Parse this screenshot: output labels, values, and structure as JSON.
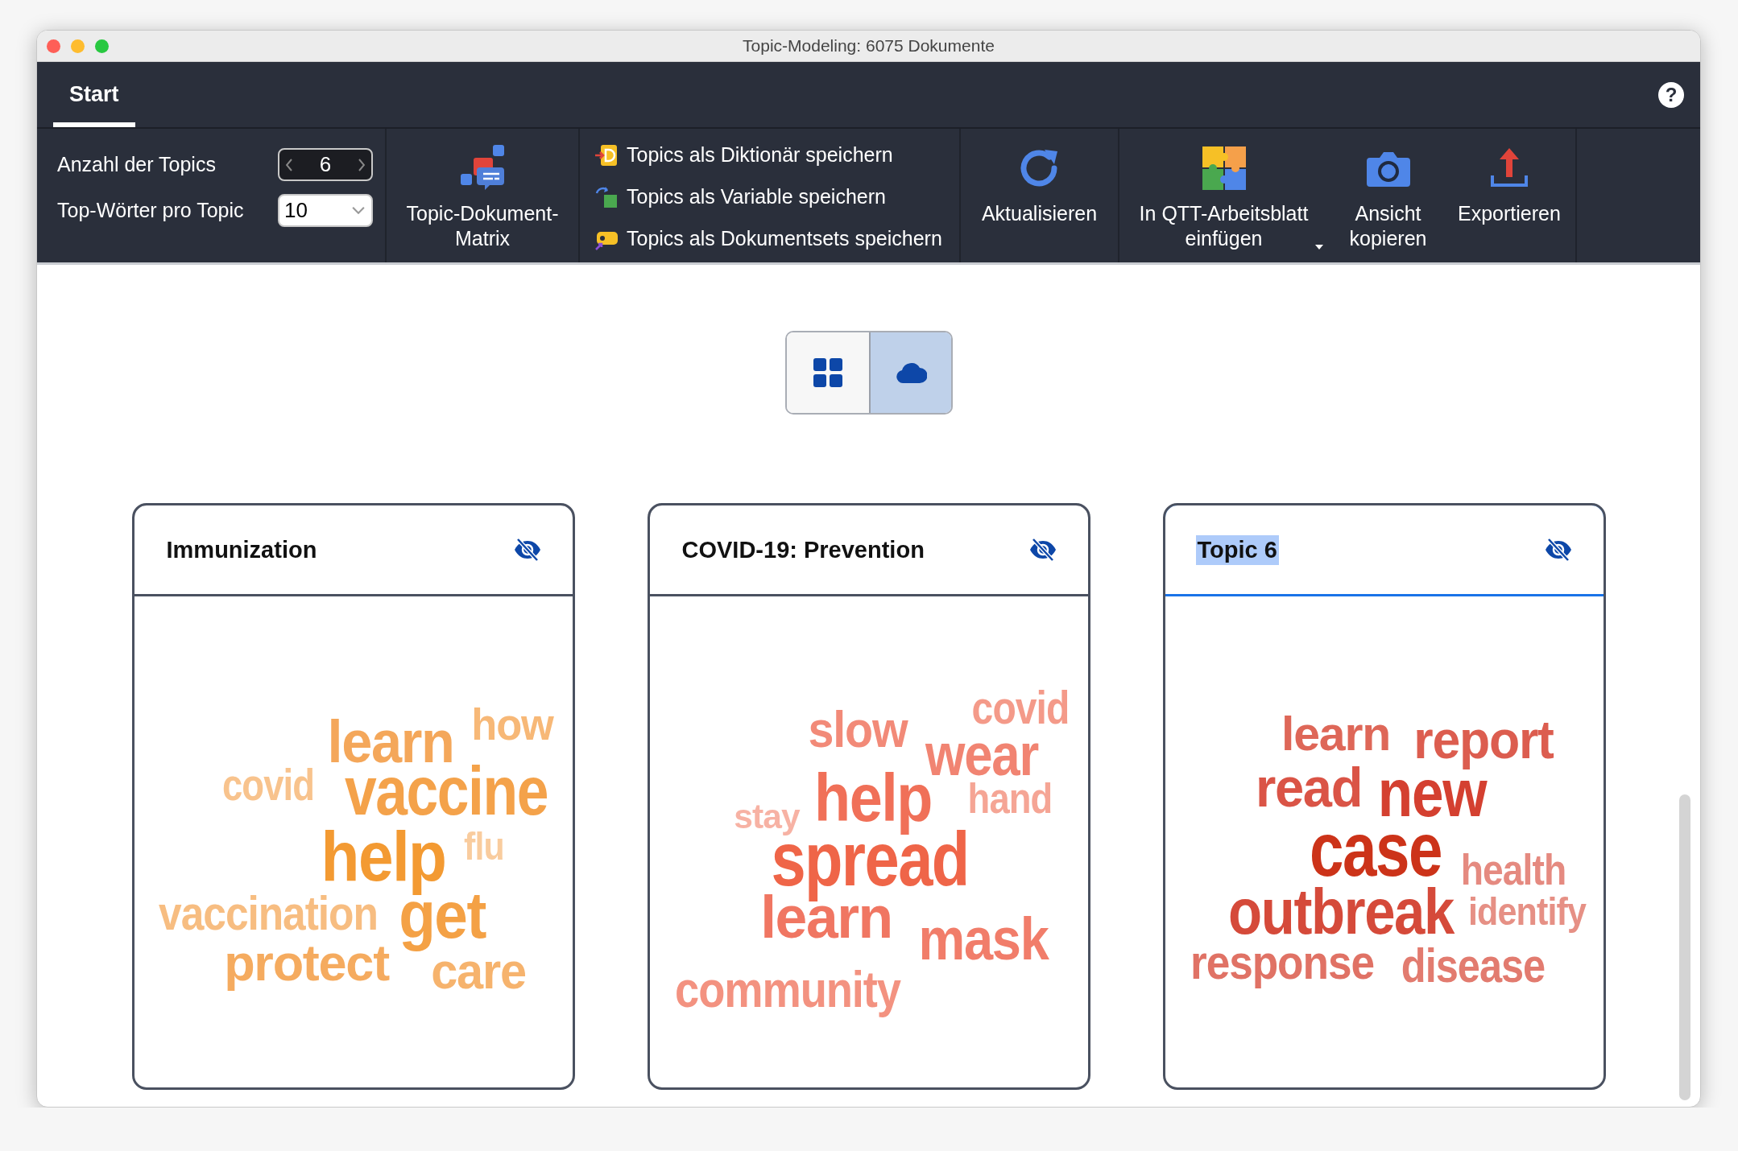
{
  "window": {
    "title": "Topic-Modeling: 6075 Dokumente"
  },
  "tabs": [
    {
      "label": "Start",
      "selected": true
    }
  ],
  "help": "?",
  "ribbon": {
    "fields": [
      {
        "kind": "spinner",
        "label": "Anzahl der Topics",
        "value": "6"
      },
      {
        "kind": "dropdown",
        "label": "Top-Wörter pro Topic",
        "value": "10"
      }
    ],
    "matrix_button": {
      "label": "Topic-Dokument-Matrix"
    },
    "save_actions": [
      {
        "kind": "dictionary",
        "label": "Topics als Diktionär speichern"
      },
      {
        "kind": "variable",
        "label": "Topics als Variable speichern"
      },
      {
        "kind": "docset",
        "label": "Topics als Dokumentsets speichern"
      }
    ],
    "refresh_button": {
      "label": "Aktualisieren"
    },
    "output_buttons": [
      {
        "kind": "worksheet",
        "label": "In QTT-Arbeitsblatt einfügen",
        "dropdown": true
      },
      {
        "kind": "camera",
        "label": "Ansicht kopieren",
        "dropdown": false
      },
      {
        "kind": "export",
        "label": "Exportieren",
        "dropdown": false
      }
    ]
  },
  "view_toggle": [
    {
      "kind": "grid",
      "selected": false
    },
    {
      "kind": "cloud",
      "selected": true
    }
  ],
  "cards": [
    {
      "title": "Immunization",
      "selected": false,
      "words": [
        {
          "text": "learn",
          "color": "#f4a75a"
        },
        {
          "text": "how",
          "color": "#f7b877"
        },
        {
          "text": "covid",
          "color": "#f8c38d"
        },
        {
          "text": "vaccine",
          "color": "#f4a24a"
        },
        {
          "text": "help",
          "color": "#f39a32"
        },
        {
          "text": "flu",
          "color": "#f9cc9e"
        },
        {
          "text": "vaccination",
          "color": "#f7bd81"
        },
        {
          "text": "get",
          "color": "#f4a145"
        },
        {
          "text": "protect",
          "color": "#f5ab5f"
        },
        {
          "text": "care",
          "color": "#f6b36d"
        }
      ]
    },
    {
      "title": "COVID-19: Prevention",
      "selected": false,
      "words": [
        {
          "text": "covid",
          "color": "#f49a89"
        },
        {
          "text": "slow",
          "color": "#f28a78"
        },
        {
          "text": "wear",
          "color": "#f18472"
        },
        {
          "text": "help",
          "color": "#f07058"
        },
        {
          "text": "hand",
          "color": "#f5a595"
        },
        {
          "text": "stay",
          "color": "#f7b2a4"
        },
        {
          "text": "spread",
          "color": "#ef6548"
        },
        {
          "text": "learn",
          "color": "#f07662"
        },
        {
          "text": "mask",
          "color": "#f17d6a"
        },
        {
          "text": "community",
          "color": "#f39280"
        }
      ]
    },
    {
      "title": "Topic 6",
      "selected": true,
      "words": [
        {
          "text": "learn",
          "color": "#de6758"
        },
        {
          "text": "report",
          "color": "#dc5d4f"
        },
        {
          "text": "read",
          "color": "#da5446"
        },
        {
          "text": "new",
          "color": "#d44030"
        },
        {
          "text": "case",
          "color": "#cc3319"
        },
        {
          "text": "health",
          "color": "#e58a80"
        },
        {
          "text": "outbreak",
          "color": "#d54a3a"
        },
        {
          "text": "identify",
          "color": "#e69085"
        },
        {
          "text": "response",
          "color": "#e07265"
        },
        {
          "text": "disease",
          "color": "#e27b6f"
        }
      ]
    }
  ]
}
